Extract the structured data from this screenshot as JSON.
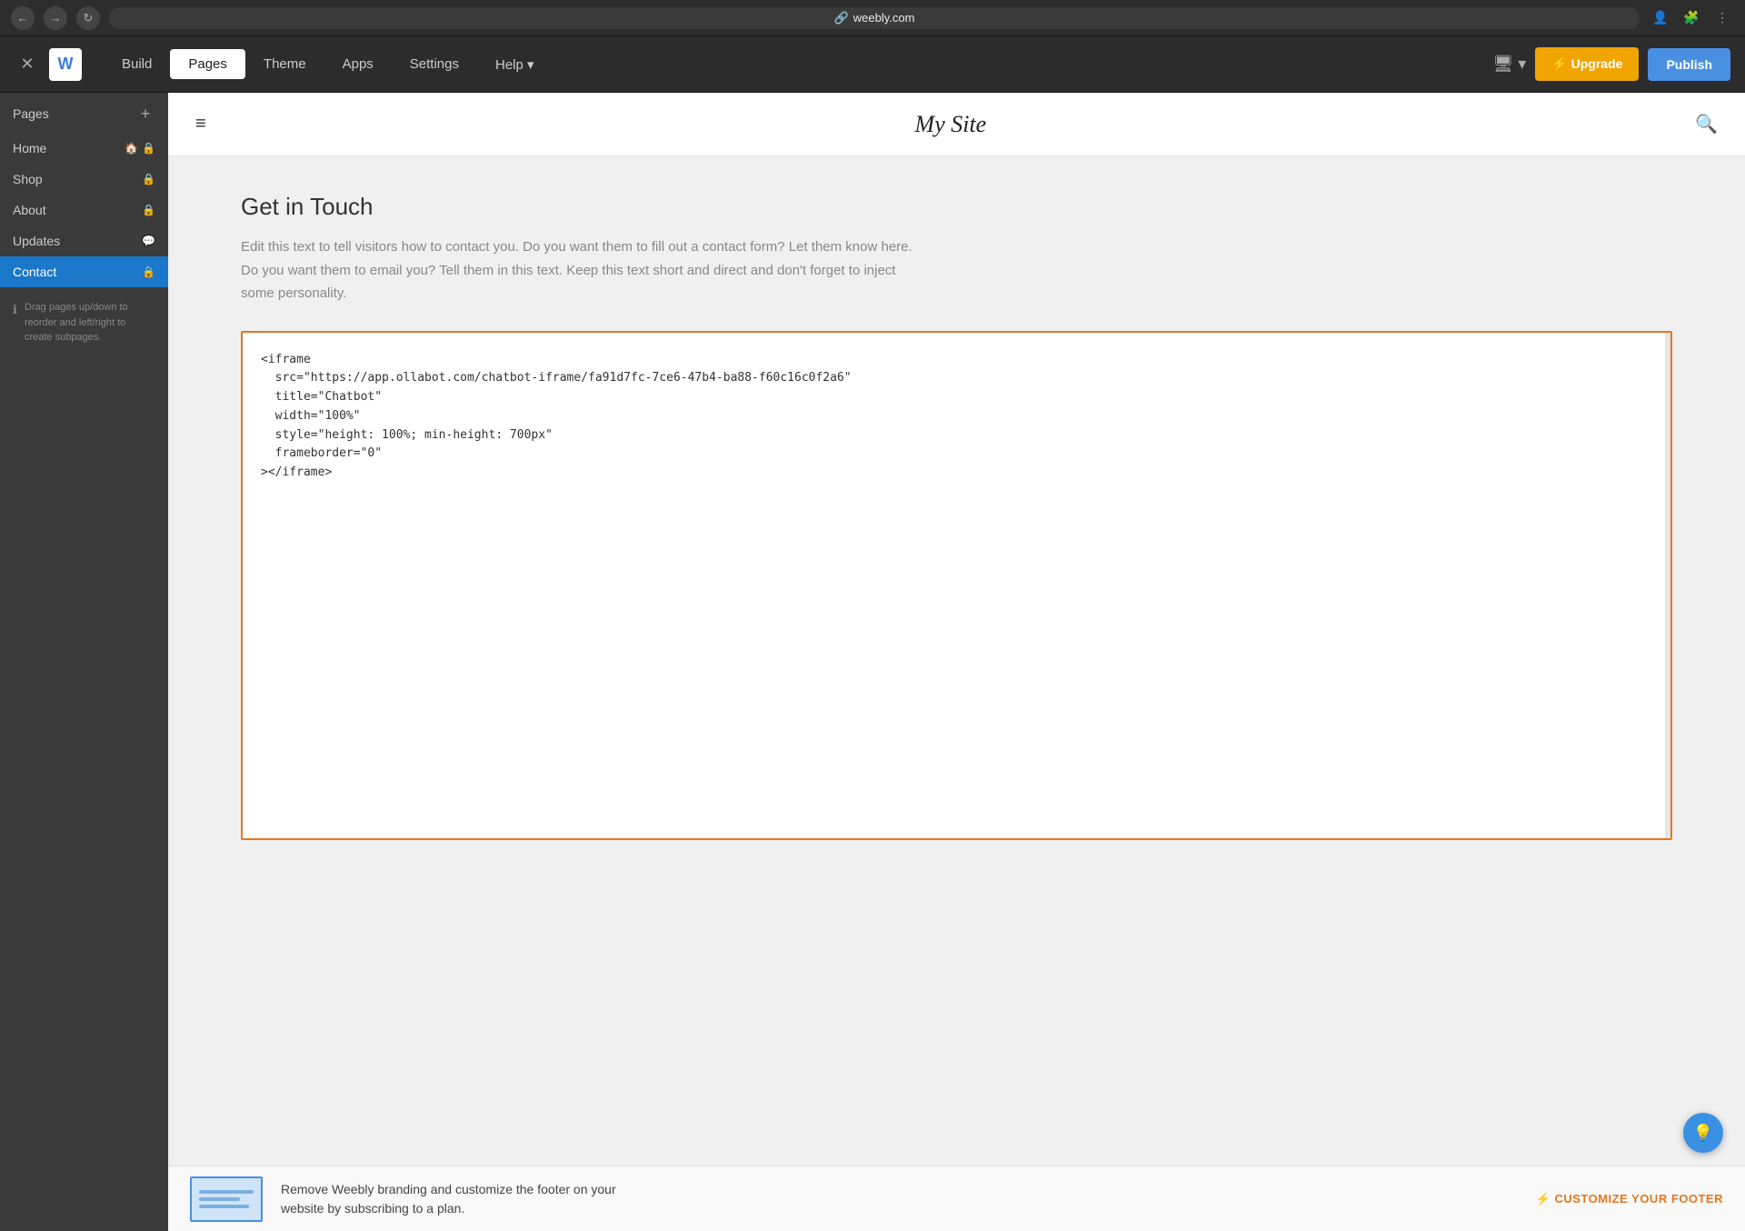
{
  "browser": {
    "back_label": "←",
    "forward_label": "→",
    "refresh_label": "↻",
    "url": "weebly.com",
    "link_icon": "🔗"
  },
  "toolbar": {
    "close_label": "✕",
    "logo_label": "W",
    "nav_items": [
      {
        "id": "build",
        "label": "Build",
        "active": false
      },
      {
        "id": "pages",
        "label": "Pages",
        "active": true
      },
      {
        "id": "theme",
        "label": "Theme",
        "active": false
      },
      {
        "id": "apps",
        "label": "Apps",
        "active": false
      },
      {
        "id": "settings",
        "label": "Settings",
        "active": false
      },
      {
        "id": "help",
        "label": "Help ▾",
        "active": false
      }
    ],
    "device_label": "🖥 ▾",
    "upgrade_label": "⚡ Upgrade",
    "publish_label": "Publish"
  },
  "sidebar": {
    "title": "Pages",
    "add_label": "+",
    "pages": [
      {
        "id": "home",
        "label": "Home",
        "icons": [
          "🏠",
          "🔒"
        ],
        "active": false
      },
      {
        "id": "shop",
        "label": "Shop",
        "icons": [
          "🔒"
        ],
        "active": false
      },
      {
        "id": "about",
        "label": "About",
        "icons": [
          "🔒"
        ],
        "active": false
      },
      {
        "id": "updates",
        "label": "Updates",
        "icons": [
          "💬"
        ],
        "active": false
      },
      {
        "id": "contact",
        "label": "Contact",
        "icons": [
          "🔒"
        ],
        "active": true
      }
    ],
    "drag_hint": "Drag pages up/down to reorder and left/right to create subpages."
  },
  "site_header": {
    "hamburger": "≡",
    "title": "My Site",
    "search": "🔍"
  },
  "page": {
    "heading": "Get in Touch",
    "description": "Edit this text to tell visitors how to contact you. Do you want them to fill out a contact form? Let them know here. Do you want them to email you? Tell them in this text. Keep this text short and direct and don't forget to inject some personality.",
    "code_content": "<iframe\n  src=\"https://app.ollabot.com/chatbot-iframe/fa91d7fc-7ce6-47b4-ba88-f60c16c0f2a6\"\n  title=\"Chatbot\"\n  width=\"100%\"\n  style=\"height: 100%; min-height: 700px\"\n  frameborder=\"0\"\n></iframe>"
  },
  "footer_banner": {
    "text_line1": "Remove Weebly branding and customize the footer on your",
    "text_line2": "website by subscribing to a plan.",
    "cta_label": "⚡ CUSTOMIZE YOUR FOOTER"
  },
  "help_fab": {
    "label": "💡"
  },
  "colors": {
    "active_nav": "#1a77c9",
    "upgrade_btn": "#f0a500",
    "publish_btn": "#4a90e2",
    "code_border": "#e07820",
    "cta_text": "#e07820"
  }
}
